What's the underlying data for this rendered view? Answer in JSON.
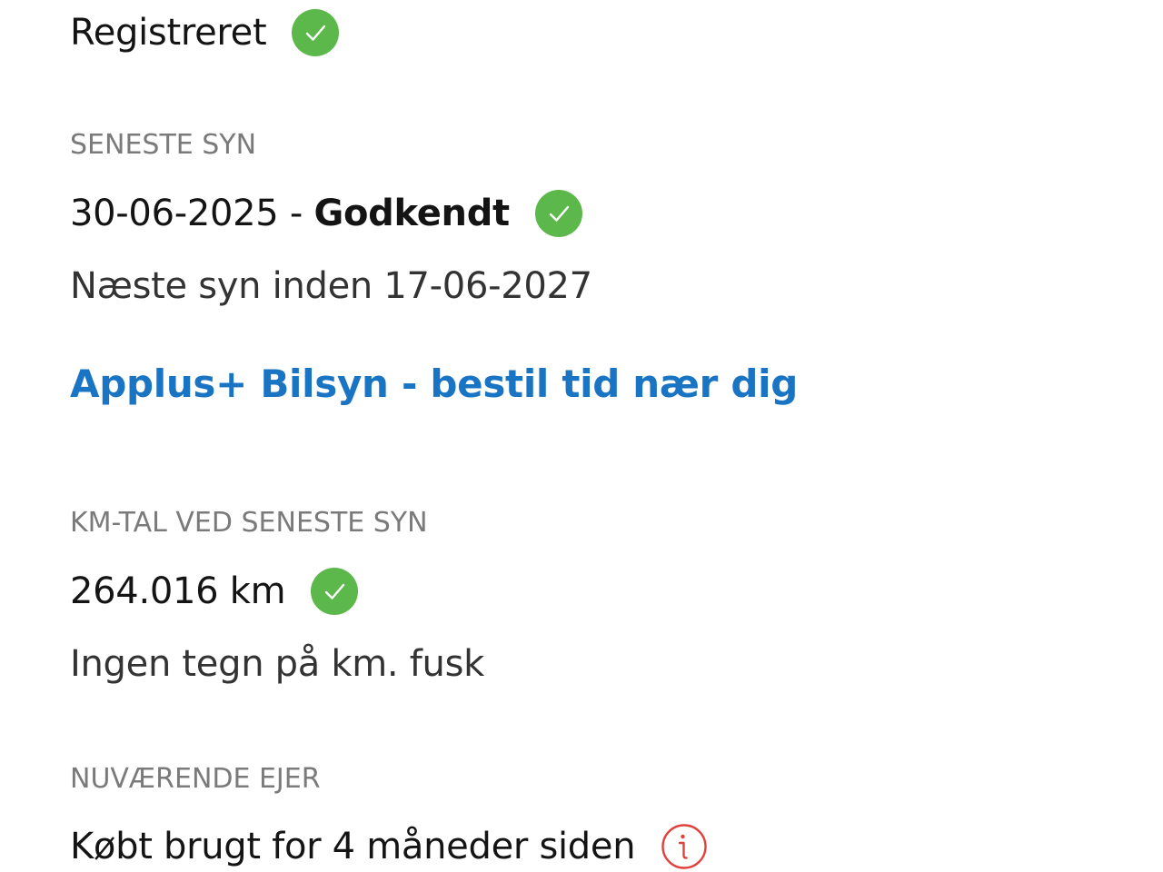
{
  "registration": {
    "status_text": "Registreret",
    "status_icon": "check-circle-icon",
    "status_color": "#5cb84a"
  },
  "inspection": {
    "label": "SENESTE SYN",
    "date": "30-06-2025",
    "separator": " - ",
    "result": "Godkendt",
    "result_icon": "check-circle-icon",
    "next_inspection": "Næste syn inden 17-06-2027",
    "booking_link": "Applus+ Bilsyn - bestil tid nær dig",
    "link_color": "#1a74c4"
  },
  "mileage": {
    "label": "KM-TAL VED SENESTE SYN",
    "value": "264.016 km",
    "value_icon": "check-circle-icon",
    "note": "Ingen tegn på km. fusk"
  },
  "owner": {
    "label": "NUVÆRENDE EJER",
    "text": "Købt brugt for 4 måneder siden",
    "info_icon": "info-icon",
    "info_color": "#e0413c"
  }
}
